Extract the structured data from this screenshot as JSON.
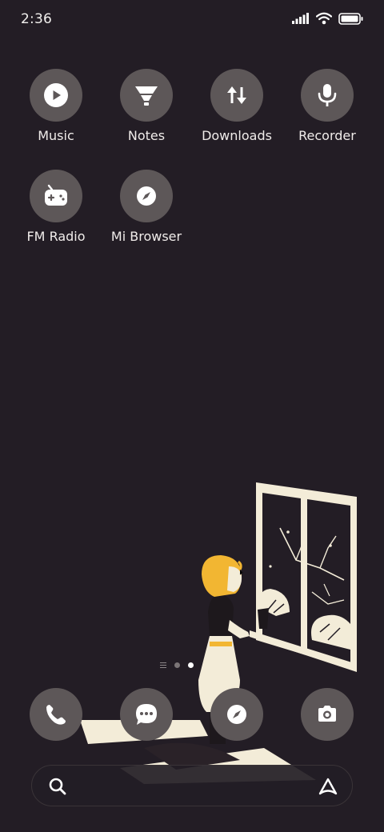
{
  "status": {
    "time": "2:36"
  },
  "apps": [
    {
      "label": "Music",
      "icon": "play-icon"
    },
    {
      "label": "Notes",
      "icon": "notes-icon"
    },
    {
      "label": "Downloads",
      "icon": "downloads-icon"
    },
    {
      "label": "Recorder",
      "icon": "microphone-icon"
    },
    {
      "label": "FM Radio",
      "icon": "radio-icon"
    },
    {
      "label": "Mi Browser",
      "icon": "compass-icon"
    }
  ],
  "dock": [
    {
      "name": "phone",
      "icon": "phone-icon"
    },
    {
      "name": "messages",
      "icon": "chat-bubble-icon"
    },
    {
      "name": "browser",
      "icon": "compass-icon"
    },
    {
      "name": "camera",
      "icon": "camera-icon"
    }
  ],
  "pager": {
    "pages": 2,
    "active": 2
  },
  "colors": {
    "background": "#231d25",
    "icon_circle": "#5d5758",
    "wallpaper_cream": "#f3ecd8",
    "wallpaper_yellow": "#f2b632"
  }
}
